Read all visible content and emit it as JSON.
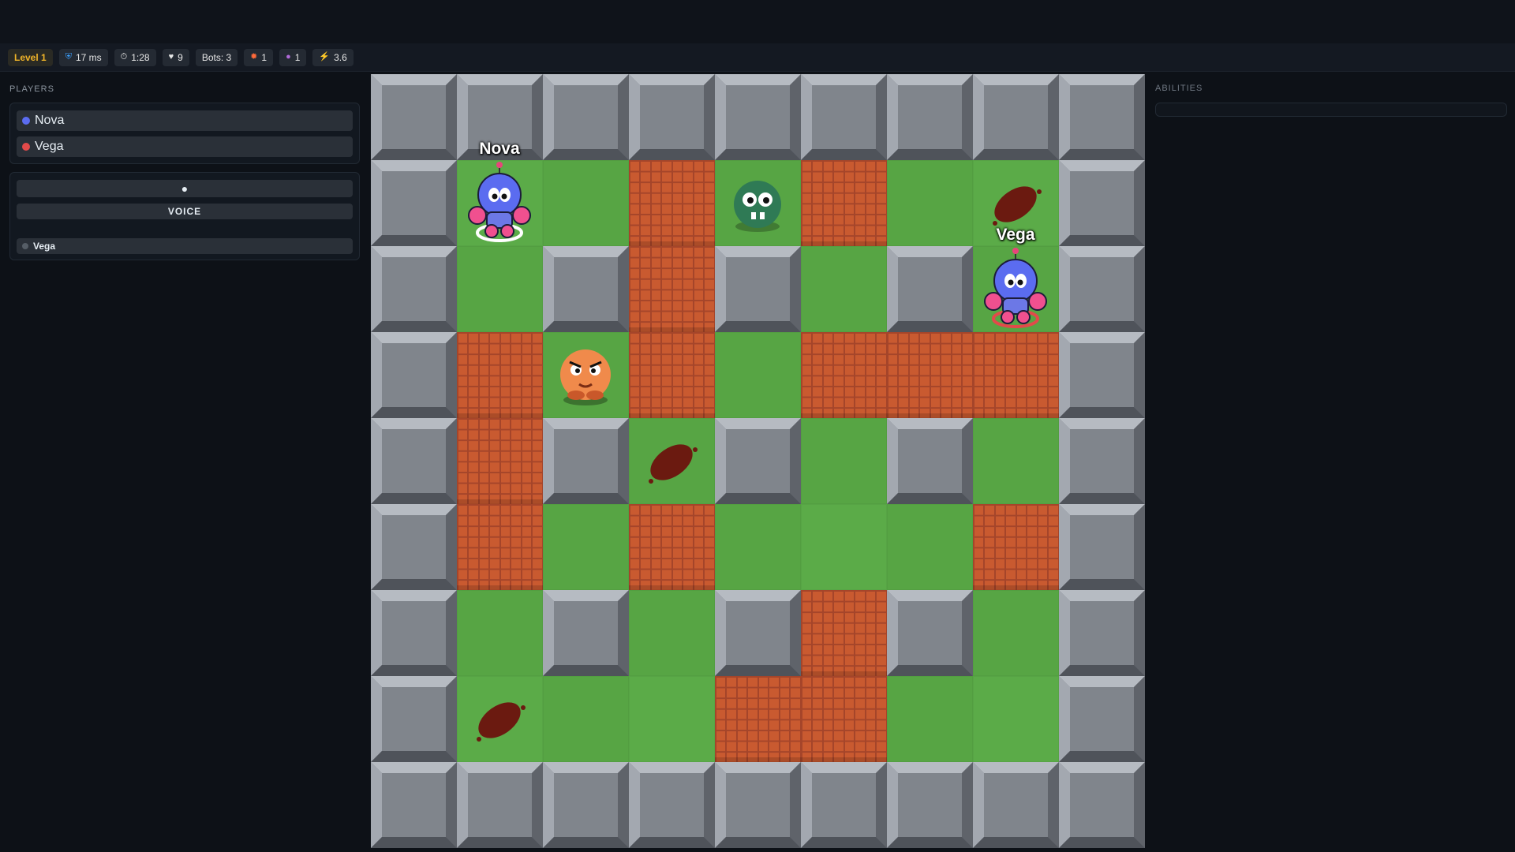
{
  "hud": {
    "level": "Level 1",
    "ping": "17 ms",
    "timer": "1:28",
    "lives": "9",
    "bots": "Bots: 3",
    "fire": "1",
    "bombs": "1",
    "speed": "3.6",
    "icons": [
      "shield-icon",
      "stopwatch-icon",
      "heart-icon",
      "fire-icon",
      "bomb-icon",
      "lightning-icon"
    ]
  },
  "players_panel": {
    "title": "PLAYERS",
    "players": [
      {
        "name": "Nova",
        "color": "#5b6cf0"
      },
      {
        "name": "Vega",
        "color": "#e24a4a"
      }
    ]
  },
  "voice_panel": {
    "mic_icon": "microphone-icon",
    "voice_label": "VOICE",
    "speakers": [
      {
        "name": "Vega"
      }
    ]
  },
  "abilities_panel": {
    "title": "ABILITIES"
  },
  "board": {
    "cols": 9,
    "rows": 9,
    "legend": {
      "W": "steel wall",
      "B": "brick block",
      "G": "grass floor"
    },
    "grid": [
      "WWWWWWWWW",
      "WGGBGBGGW",
      "WGWBWGWGW",
      "WBGBGBBBW",
      "WBWGWGWGW",
      "WBGBGGGBW",
      "WGWGWBWGW",
      "WGGGBBGGW",
      "WWWWWWWWW"
    ],
    "players": [
      {
        "name": "Nova",
        "col": 1,
        "row": 1,
        "color": "#5b6cf0",
        "ring": "#ffffff"
      },
      {
        "name": "Vega",
        "col": 7,
        "row": 2,
        "color": "#5b6cf0",
        "ring": "#e24a4a"
      }
    ],
    "enemies": [
      {
        "kind": "green-blob",
        "col": 4,
        "row": 1,
        "color": "#2f7a55"
      },
      {
        "kind": "orange-brute",
        "col": 2,
        "row": 3,
        "color": "#f08a4b"
      }
    ],
    "scorch_marks": [
      {
        "col": 7,
        "row": 1
      },
      {
        "col": 3,
        "row": 4
      },
      {
        "col": 1,
        "row": 7
      }
    ],
    "colors": {
      "grass": "#57a544",
      "brick": "#c95a30",
      "wall": "#80858c"
    }
  }
}
